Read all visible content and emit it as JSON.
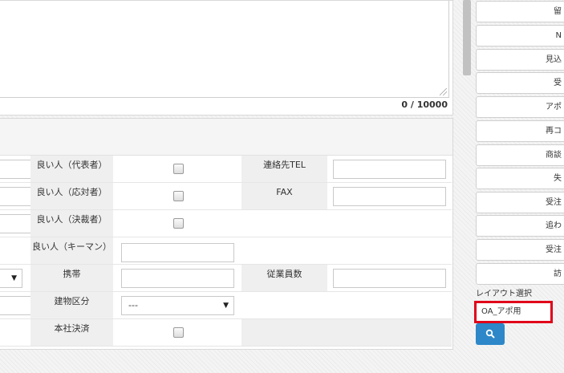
{
  "memo": {
    "char_count": "0 / 10000"
  },
  "form": {
    "good_person_rep": "良い人（代表者）",
    "good_person_resp": "良い人（応対者）",
    "good_person_decision": "良い人（決裁者）",
    "good_person_key": "良い人（キーマン）",
    "contact_tel": "連絡先TEL",
    "fax": "FAX",
    "mobile": "携帯",
    "employees": "従業員数",
    "building_category": "建物区分",
    "building_category_value": "---",
    "hq_decision": "本社決済"
  },
  "sidebar": {
    "buttons": [
      "留",
      "N",
      "見込",
      "受",
      "アポ",
      "再コ",
      "商談",
      "失",
      "受注",
      "追わ",
      "受注",
      "訪"
    ],
    "layout_label": "レイアウト選択",
    "layout_value": "OA_アポ用"
  },
  "icons": {
    "search": "search-icon",
    "dropdown": "chevron-down-icon"
  },
  "colors": {
    "highlight": "#e0001a",
    "primary": "#2d87c8"
  }
}
